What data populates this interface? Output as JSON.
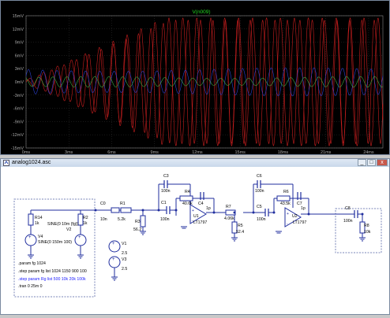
{
  "plot": {
    "trace_name": "V(n009)",
    "y_ticks": [
      "15mV",
      "12mV",
      "9mV",
      "6mV",
      "3mV",
      "0mV",
      "-3mV",
      "-6mV",
      "-9mV",
      "-12mV",
      "-15mV"
    ],
    "x_ticks": [
      "0ms",
      "3ms",
      "6ms",
      "9ms",
      "12ms",
      "15ms",
      "18ms",
      "21ms",
      "24ms"
    ]
  },
  "schematic_window": {
    "title": "analog1024.asc",
    "buttons": [
      "_",
      "□",
      "x"
    ]
  },
  "components": {
    "r14": {
      "name": "R14",
      "value": "1k"
    },
    "r2": {
      "name": "R2",
      "value": "1k"
    },
    "v4": {
      "name": "V4",
      "value": "SINE(0 150m 100)"
    },
    "v2": {
      "name": "V2",
      "value": "SINE(0 10m {fg})"
    },
    "c0": {
      "name": "C0",
      "value": "10n"
    },
    "r1": {
      "name": "R1",
      "value": "5.2k"
    },
    "r3": {
      "name": "R3",
      "value": "56.2"
    },
    "c3": {
      "name": "C3",
      "value": "100n"
    },
    "c1": {
      "name": "C1",
      "value": "100n"
    },
    "r4": {
      "name": "R4",
      "value": "40.6k"
    },
    "c4": {
      "name": "C4",
      "value": "1p"
    },
    "u1": {
      "name": "U1",
      "value": "LT1797"
    },
    "r7": {
      "name": "R7",
      "value": "4.06k"
    },
    "r5": {
      "name": "R5",
      "value": "52.4"
    },
    "c6": {
      "name": "C6",
      "value": "100n"
    },
    "c5": {
      "name": "C5",
      "value": "100n"
    },
    "r6": {
      "name": "R6",
      "value": "43.5k"
    },
    "c7": {
      "name": "C7",
      "value": "1p"
    },
    "u2": {
      "name": "U2",
      "value": "LT1797"
    },
    "c8": {
      "name": "C8",
      "value": "100n"
    },
    "r8": {
      "name": "R8",
      "value": "10k"
    },
    "v1": {
      "name": "V1",
      "value": "2.5"
    },
    "v3": {
      "name": "V3",
      "value": "2.5"
    }
  },
  "directives": {
    "param": ".param fg 1024",
    "step1": ".step param fg list  1024 1150 900 100",
    "step2": ".step param Rg list  500 10k 20k 100k",
    "tran": ".tran 0 25m 0"
  },
  "colors": {
    "trace_red": "#c81e1e",
    "trace_blue": "#2b3fd0",
    "trace_green": "#3fa53f",
    "trace_label": "#22dd22",
    "directive_blue": "#1a1aff",
    "wire": "#1f2d9e"
  }
}
